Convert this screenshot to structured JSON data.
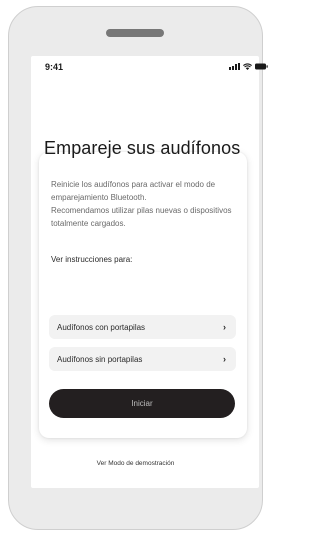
{
  "status_bar": {
    "time": "9:41"
  },
  "screen": {
    "title": "Empareje sus audífonos",
    "description": [
      "Reinicie los audífonos para activar el modo de emparejamiento Bluetooth.",
      "Recomendamos utilizar pilas nuevas o dispositivos totalmente cargados."
    ],
    "instructions_label": "Ver instrucciones para:",
    "options": [
      {
        "label": "Audífonos con portapilas",
        "chevron": "›"
      },
      {
        "label": "Audífonos sin portapilas",
        "chevron": "›"
      }
    ],
    "start_button": "Iniciar",
    "demo_link": "Ver Modo de demostración"
  },
  "colors": {
    "device_bg": "#ebebeb",
    "button_bg": "#231f20",
    "option_bg": "#f2f2f2"
  }
}
